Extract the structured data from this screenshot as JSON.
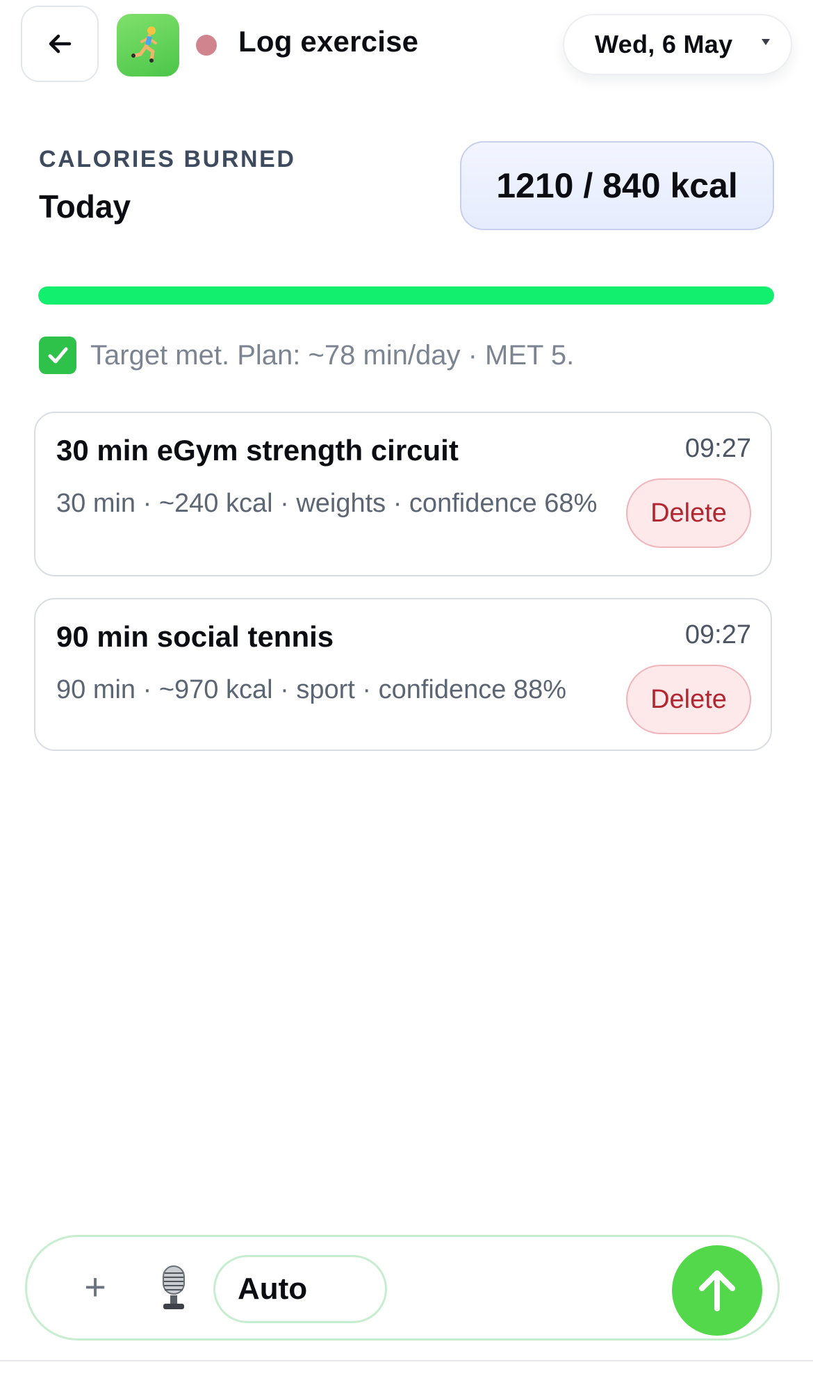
{
  "header": {
    "title": "Log exercise",
    "date": "Wed, 6 May",
    "app_icon": "person-running-icon",
    "status_color": "#d0848e"
  },
  "summary": {
    "eyebrow": "CALORIES BURNED",
    "period": "Today",
    "kcal_text": "1210 / 840 kcal",
    "progress_fraction": 1.0,
    "progress_color": "#12ee6e",
    "note": "Target met. Plan: ~78 min/day · MET 5."
  },
  "entries": [
    {
      "title": "30 min eGym strength circuit",
      "time": "09:27",
      "meta": "30 min · ~240 kcal · weights · confidence 68%",
      "delete_label": "Delete"
    },
    {
      "title": "90 min social tennis",
      "time": "09:27",
      "meta": "90 min · ~970 kcal · sport · confidence 88%",
      "delete_label": "Delete"
    }
  ],
  "composer": {
    "plus_label": "+",
    "mode": "Auto",
    "accent": "#52d84a"
  }
}
